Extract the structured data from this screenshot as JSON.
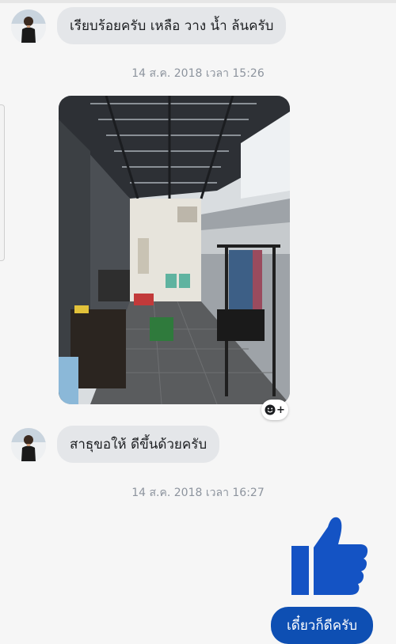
{
  "conversation": {
    "messages": [
      {
        "sender": "other",
        "text": "เรียบร้อยครับ เหลือ วาง น้ำ ล้นครับ"
      },
      {
        "sender": "other",
        "type": "photo",
        "image_description_icon": "photo-of-covered-side-alley"
      },
      {
        "sender": "other",
        "text": "สาธุขอให้ ดีขึ้นด้วยครับ"
      },
      {
        "sender": "me",
        "type": "like-sticker",
        "icon": "thumbs-up-icon"
      },
      {
        "sender": "me",
        "text": "เดี๋ยวก็ดีครับ"
      }
    ],
    "timestamps": [
      "14 ส.ค. 2018 เวลา 15:26",
      "14 ส.ค. 2018 เวลา 16:27"
    ]
  },
  "reaction_button": {
    "icon": "smiley-plus-icon",
    "symbol": "+"
  },
  "colors": {
    "background": "#f6f6f6",
    "incoming_bubble": "#e4e6e9",
    "outgoing_bubble": "#0e4fb3",
    "like_blue": "#1453c4",
    "timestamp": "#8d949e"
  }
}
